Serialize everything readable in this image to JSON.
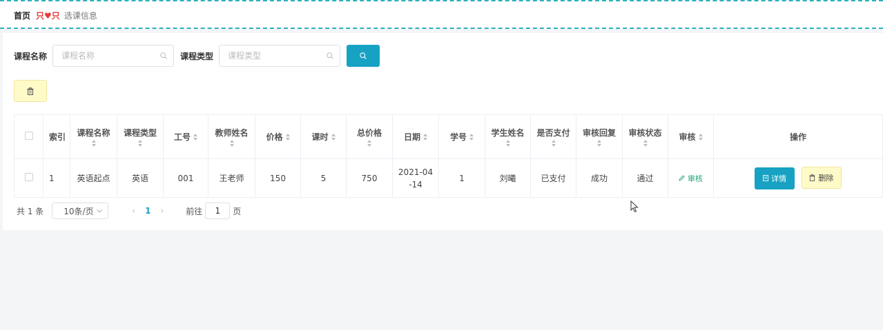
{
  "breadcrumb": {
    "home": "首页",
    "separator_left": "只",
    "separator_right": "只",
    "current": "选课信息"
  },
  "search": {
    "course_name_label": "课程名称",
    "course_name_placeholder": "课程名称",
    "course_type_label": "课程类型",
    "course_type_placeholder": "课程类型"
  },
  "table": {
    "headers": [
      "索引",
      "课程名称",
      "课程类型",
      "工号",
      "教师姓名",
      "价格",
      "课时",
      "总价格",
      "日期",
      "学号",
      "学生姓名",
      "是否支付",
      "审核回复",
      "审核状态",
      "审核",
      "操作"
    ],
    "rows": [
      {
        "index": "1",
        "course_name": "英语起点",
        "course_type": "英语",
        "teacher_id": "001",
        "teacher_name": "王老师",
        "price": "150",
        "hours": "5",
        "total_price": "750",
        "date": "2021-04-14",
        "student_id": "1",
        "student_name": "刘曦",
        "paid": "已支付",
        "audit_reply": "成功",
        "audit_status": "通过",
        "audit_action": "审核",
        "detail_label": "详情",
        "delete_label": "删除"
      }
    ]
  },
  "pagination": {
    "total": "共 1 条",
    "page_size": "10条/页",
    "current_page": "1",
    "goto_label": "前往",
    "goto_value": "1",
    "page_suffix": "页"
  },
  "colors": {
    "primary": "#17a2c4",
    "warning_bg": "#fffbc8",
    "success": "#22a67a",
    "accent_dash": "#2ab0c0"
  }
}
